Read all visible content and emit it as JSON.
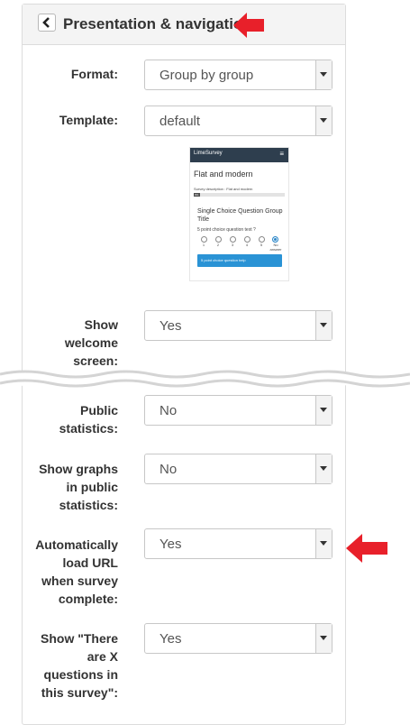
{
  "header": {
    "title": "Presentation & navigation",
    "back_icon": "chevron-left-icon"
  },
  "fields": [
    {
      "label": "Format:",
      "value": "Group by group"
    },
    {
      "label": "Template:",
      "value": "default"
    },
    {
      "label": "Show welcome screen:",
      "value": "Yes"
    },
    {
      "label": "Public statistics:",
      "value": "No"
    },
    {
      "label": "Show graphs in public statistics:",
      "value": "No"
    },
    {
      "label": "Automatically load URL when survey complete:",
      "value": "Yes"
    },
    {
      "label": "Show \"There are X questions in this survey\":",
      "value": "Yes"
    }
  ],
  "label_lines": {
    "welcome": [
      "Show",
      "welcome",
      "screen:"
    ],
    "public_stats": [
      "Public",
      "statistics:"
    ],
    "graphs": [
      "Show graphs",
      "in public",
      "statistics:"
    ],
    "autoload": [
      "Automatically",
      "load URL",
      "when survey",
      "complete:"
    ],
    "xquestions": [
      "Show \"There",
      "are X",
      "questions in",
      "this survey\":"
    ]
  },
  "preview": {
    "brand": "LimeSurvey",
    "title": "Flat and modern",
    "description": "Survey description : Flat and modern",
    "progress": "0%",
    "progress_fraction": 0.07,
    "question_group_title": "Single Choice Question Group Title",
    "question_text": "5 point choice question text ?",
    "options": [
      "1",
      "2",
      "3",
      "4",
      "5",
      "No answer"
    ],
    "selected_option": "No answer",
    "help_text": "5 point choice question help"
  },
  "colors": {
    "annotation_arrow": "#e8202a",
    "preview_nav": "#2e3e4e",
    "preview_help": "#2a93d5"
  }
}
